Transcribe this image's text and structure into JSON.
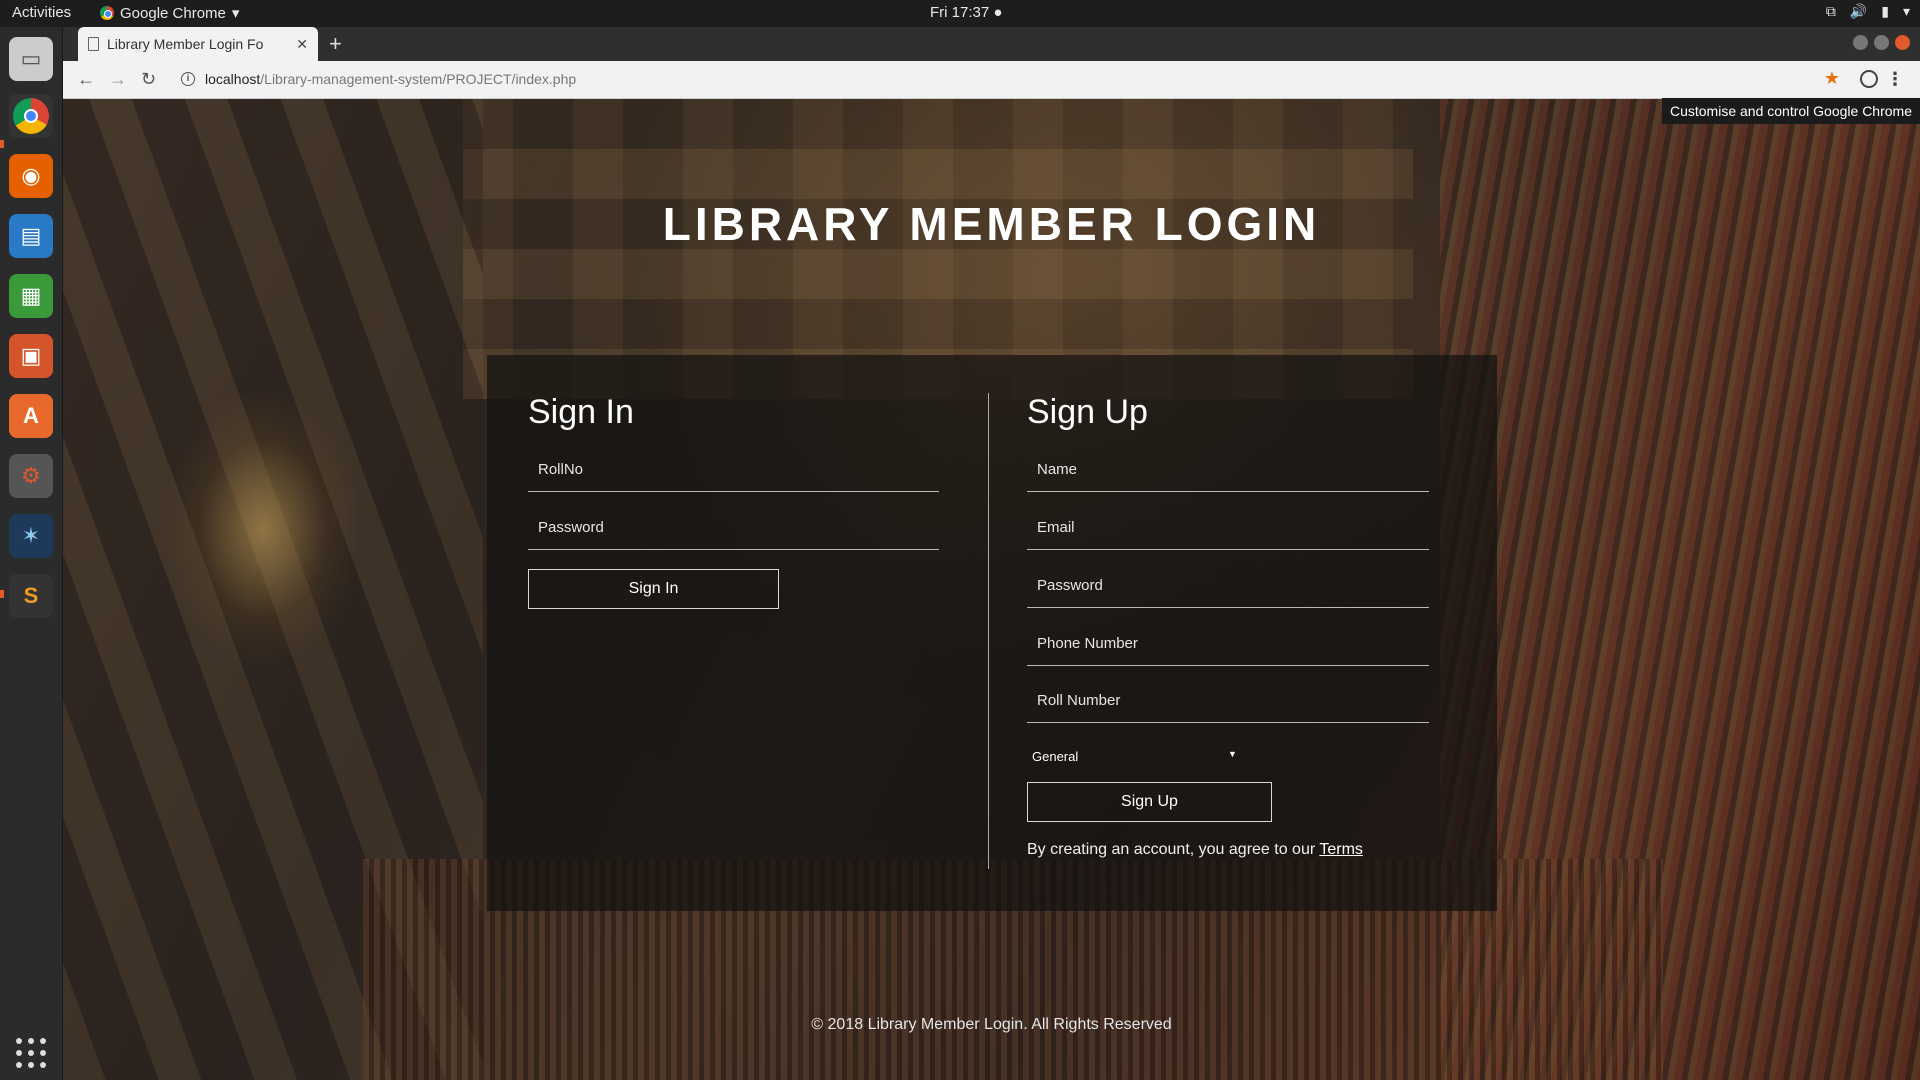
{
  "system": {
    "activities": "Activities",
    "app_menu": "Google Chrome",
    "clock": "Fri 17:37"
  },
  "browser": {
    "tab_title": "Library Member Login Fo",
    "url_host": "localhost",
    "url_path": "/Library-management-system/PROJECT/index.php",
    "tooltip": "Customise and control Google Chrome"
  },
  "page": {
    "title": "LIBRARY MEMBER LOGIN",
    "signin": {
      "heading": "Sign In",
      "rollno_placeholder": "RollNo",
      "password_placeholder": "Password",
      "button": "Sign In"
    },
    "signup": {
      "heading": "Sign Up",
      "name_placeholder": "Name",
      "email_placeholder": "Email",
      "password_placeholder": "Password",
      "phone_placeholder": "Phone Number",
      "roll_placeholder": "Roll Number",
      "category_selected": "General",
      "button": "Sign Up",
      "terms_text": "By creating an account, you agree to our",
      "terms_link": "Terms"
    },
    "footer": "© 2018 Library Member Login. All Rights Reserved"
  },
  "colors": {
    "accent_star": "#e8710a",
    "close_button": "#e05a2b"
  }
}
